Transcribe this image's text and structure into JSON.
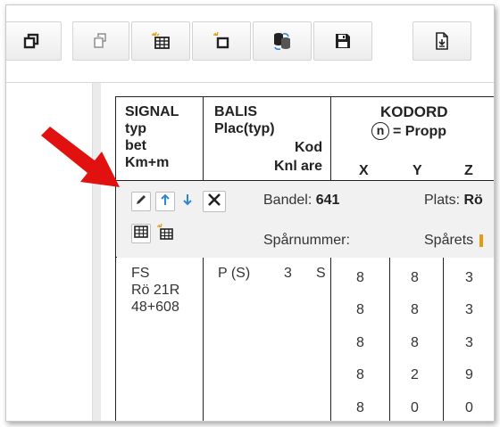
{
  "toolbar": {
    "buttons": [
      {
        "name": "copy-window",
        "icon": "window-copy-icon"
      },
      {
        "name": "paste-window",
        "icon": "window-paste-icon"
      },
      {
        "name": "new-table",
        "icon": "table-sparkle-icon"
      },
      {
        "name": "new-object",
        "icon": "square-sparkle-icon"
      },
      {
        "name": "database-sync",
        "icon": "database-sync-icon"
      },
      {
        "name": "save",
        "icon": "floppy-disk-icon"
      },
      {
        "name": "export-document",
        "icon": "document-export-icon"
      }
    ]
  },
  "header": {
    "signal": {
      "line1": "SIGNAL",
      "line2": "typ",
      "line3": "bet",
      "line4": "Km+m"
    },
    "balis": {
      "line1": "BALIS",
      "line2": "Plac(typ)",
      "kod": "Kod",
      "knl": "Knl",
      "are": "are"
    },
    "kodord": {
      "title": "KODORD",
      "propp_symbol": "n",
      "propp_label": "= Propp",
      "cols": [
        "X",
        "Y",
        "Z"
      ]
    }
  },
  "edit_band": {
    "bandel_label": "Bandel:",
    "bandel_value": "641",
    "plats_label": "Plats:",
    "plats_value": "Rö",
    "sparnummer_label": "Spårnummer:",
    "sparets_label": "Spårets"
  },
  "row": {
    "signal": [
      "FS",
      "Rö 21R",
      "48+608"
    ],
    "balis_plac": "P (S)",
    "knl": "3",
    "are": "S",
    "kodord_rows": [
      [
        "8",
        "8",
        "3"
      ],
      [
        "8",
        "8",
        "3"
      ],
      [
        "8",
        "8",
        "3"
      ],
      [
        "8",
        "2",
        "9"
      ],
      [
        "8",
        "0",
        "0"
      ]
    ]
  },
  "colors": {
    "arrow": "#e0110f",
    "accent_blue": "#2f86d6",
    "band_bg": "#f1f1f1"
  }
}
